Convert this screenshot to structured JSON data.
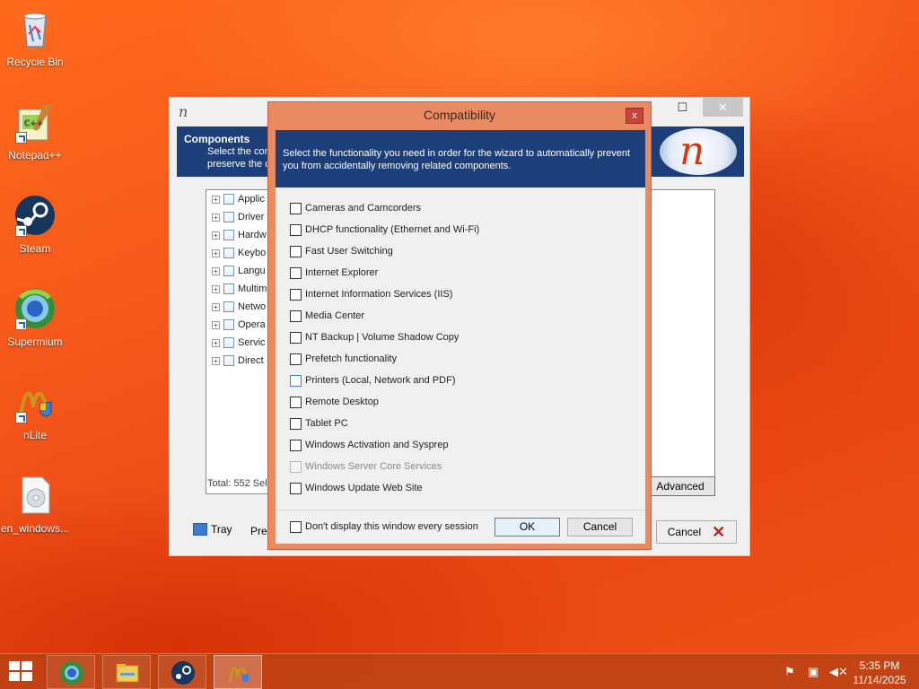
{
  "desktop": {
    "icons": [
      {
        "label": "Recycle Bin",
        "icon": "recycle-bin-icon"
      },
      {
        "label": "Notepad++",
        "icon": "notepad-plus-plus-icon"
      },
      {
        "label": "Steam",
        "icon": "steam-icon"
      },
      {
        "label": "Supermium",
        "icon": "supermium-icon"
      },
      {
        "label": "nLite",
        "icon": "nlite-icon"
      },
      {
        "label": "en_windows...",
        "icon": "disc-image-icon"
      }
    ]
  },
  "main_window": {
    "header_title": "Components",
    "header_subtitle_line1": "Select the com",
    "header_subtitle_line2": "preserve the c",
    "tree_items": [
      "Applic",
      "Driver",
      "Hardw",
      "Keybo",
      "Langu",
      "Multim",
      "Netwo",
      "Opera",
      "Servic",
      "Direct"
    ],
    "total_text": "Total: 552 Sel",
    "advanced_label": "Advanced",
    "tray_label": "Tray",
    "pres_label": "Pres",
    "cancel_label": "Cancel"
  },
  "dialog": {
    "title": "Compatibility",
    "close_glyph": "x",
    "header_text": "Select the functionality you need in order for the wizard to automatically prevent you from accidentally removing related components.",
    "options": [
      {
        "label": "Cameras and Camcorders",
        "checked": false,
        "enabled": true
      },
      {
        "label": "DHCP functionality (Ethernet and Wi-Fi)",
        "checked": false,
        "enabled": true
      },
      {
        "label": "Fast User Switching",
        "checked": false,
        "enabled": true
      },
      {
        "label": "Internet Explorer",
        "checked": false,
        "enabled": true
      },
      {
        "label": "Internet Information Services (IIS)",
        "checked": false,
        "enabled": true
      },
      {
        "label": "Media Center",
        "checked": false,
        "enabled": true
      },
      {
        "label": "NT Backup | Volume Shadow Copy",
        "checked": false,
        "enabled": true
      },
      {
        "label": "Prefetch functionality",
        "checked": false,
        "enabled": true
      },
      {
        "label": "Printers (Local, Network and PDF)",
        "checked": false,
        "enabled": true
      },
      {
        "label": "Remote Desktop",
        "checked": false,
        "enabled": true
      },
      {
        "label": "Tablet PC",
        "checked": false,
        "enabled": true
      },
      {
        "label": "Windows Activation and Sysprep",
        "checked": false,
        "enabled": true
      },
      {
        "label": "Windows Server Core Services",
        "checked": false,
        "enabled": false
      },
      {
        "label": "Windows Update Web Site",
        "checked": false,
        "enabled": true
      }
    ],
    "dont_display_label": "Don't display this window every session",
    "ok_label": "OK",
    "cancel_label": "Cancel"
  },
  "taskbar": {
    "buttons": [
      "supermium-icon",
      "file-explorer-icon",
      "steam-icon",
      "nlite-icon"
    ],
    "clock_time": "5:35 PM",
    "clock_date": "11/14/2025"
  }
}
